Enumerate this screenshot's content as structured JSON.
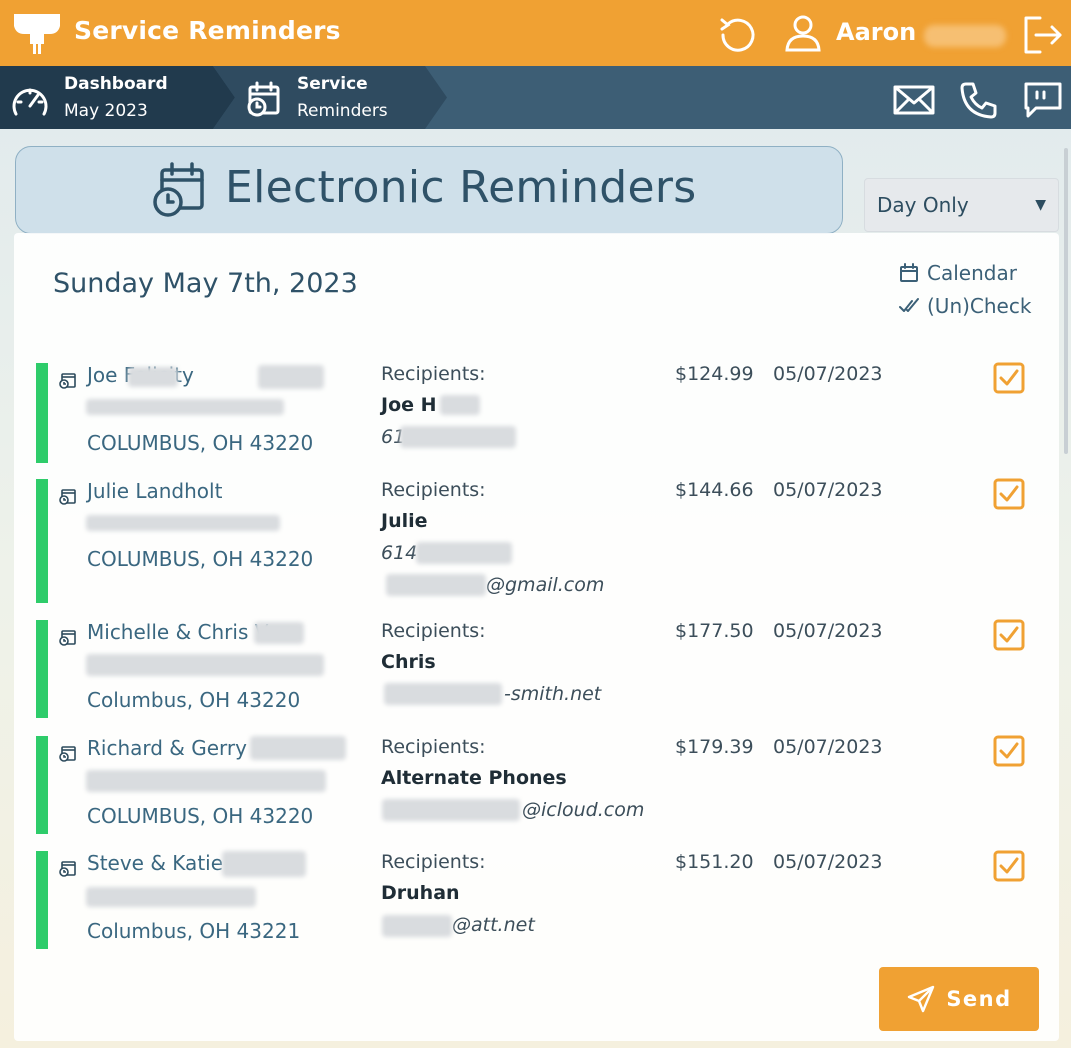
{
  "app": {
    "title": "Service Reminders",
    "user_name": "Aaron"
  },
  "nav": {
    "crumbs": [
      {
        "title": "Dashboard",
        "sub": "May 2023"
      },
      {
        "title": "Service",
        "sub": "Reminders"
      }
    ]
  },
  "header": {
    "title": "Electronic Reminders"
  },
  "filter": {
    "selected": "Day Only"
  },
  "main": {
    "date_heading": "Sunday May 7th, 2023",
    "calendar_link": "Calendar",
    "uncheck_link": "(Un)Check",
    "recipients_label": "Recipients:"
  },
  "rows": [
    {
      "name": "Joe      Felicity",
      "address2": "COLUMBUS, OH 43220",
      "recipient": "Joe H",
      "lines": [
        "61"
      ],
      "amount": "$124.99",
      "date": "05/07/2023"
    },
    {
      "name": "Julie Landholt",
      "address2": "COLUMBUS, OH 43220",
      "recipient": "Julie",
      "lines": [
        "614",
        "@gmail.com"
      ],
      "amount": "$144.66",
      "date": "05/07/2023"
    },
    {
      "name": "Michelle & Chris V",
      "address2": "Columbus, OH 43220",
      "recipient": "Chris",
      "lines": [
        "-smith.net"
      ],
      "amount": "$177.50",
      "date": "05/07/2023"
    },
    {
      "name": "Richard & Gerry",
      "address2": "COLUMBUS, OH 43220",
      "recipient": "Alternate Phones",
      "lines": [
        "@icloud.com"
      ],
      "amount": "$179.39",
      "date": "05/07/2023"
    },
    {
      "name": "Steve & Katie",
      "address2": "Columbus, OH 43221",
      "recipient": "Druhan",
      "lines": [
        "@att.net"
      ],
      "amount": "$151.20",
      "date": "05/07/2023"
    }
  ],
  "send_label": "Send",
  "colors": {
    "accent": "#f0a133",
    "nav_dark": "#213a4d",
    "nav": "#3d5e75",
    "row_bar": "#2ecc6a"
  }
}
